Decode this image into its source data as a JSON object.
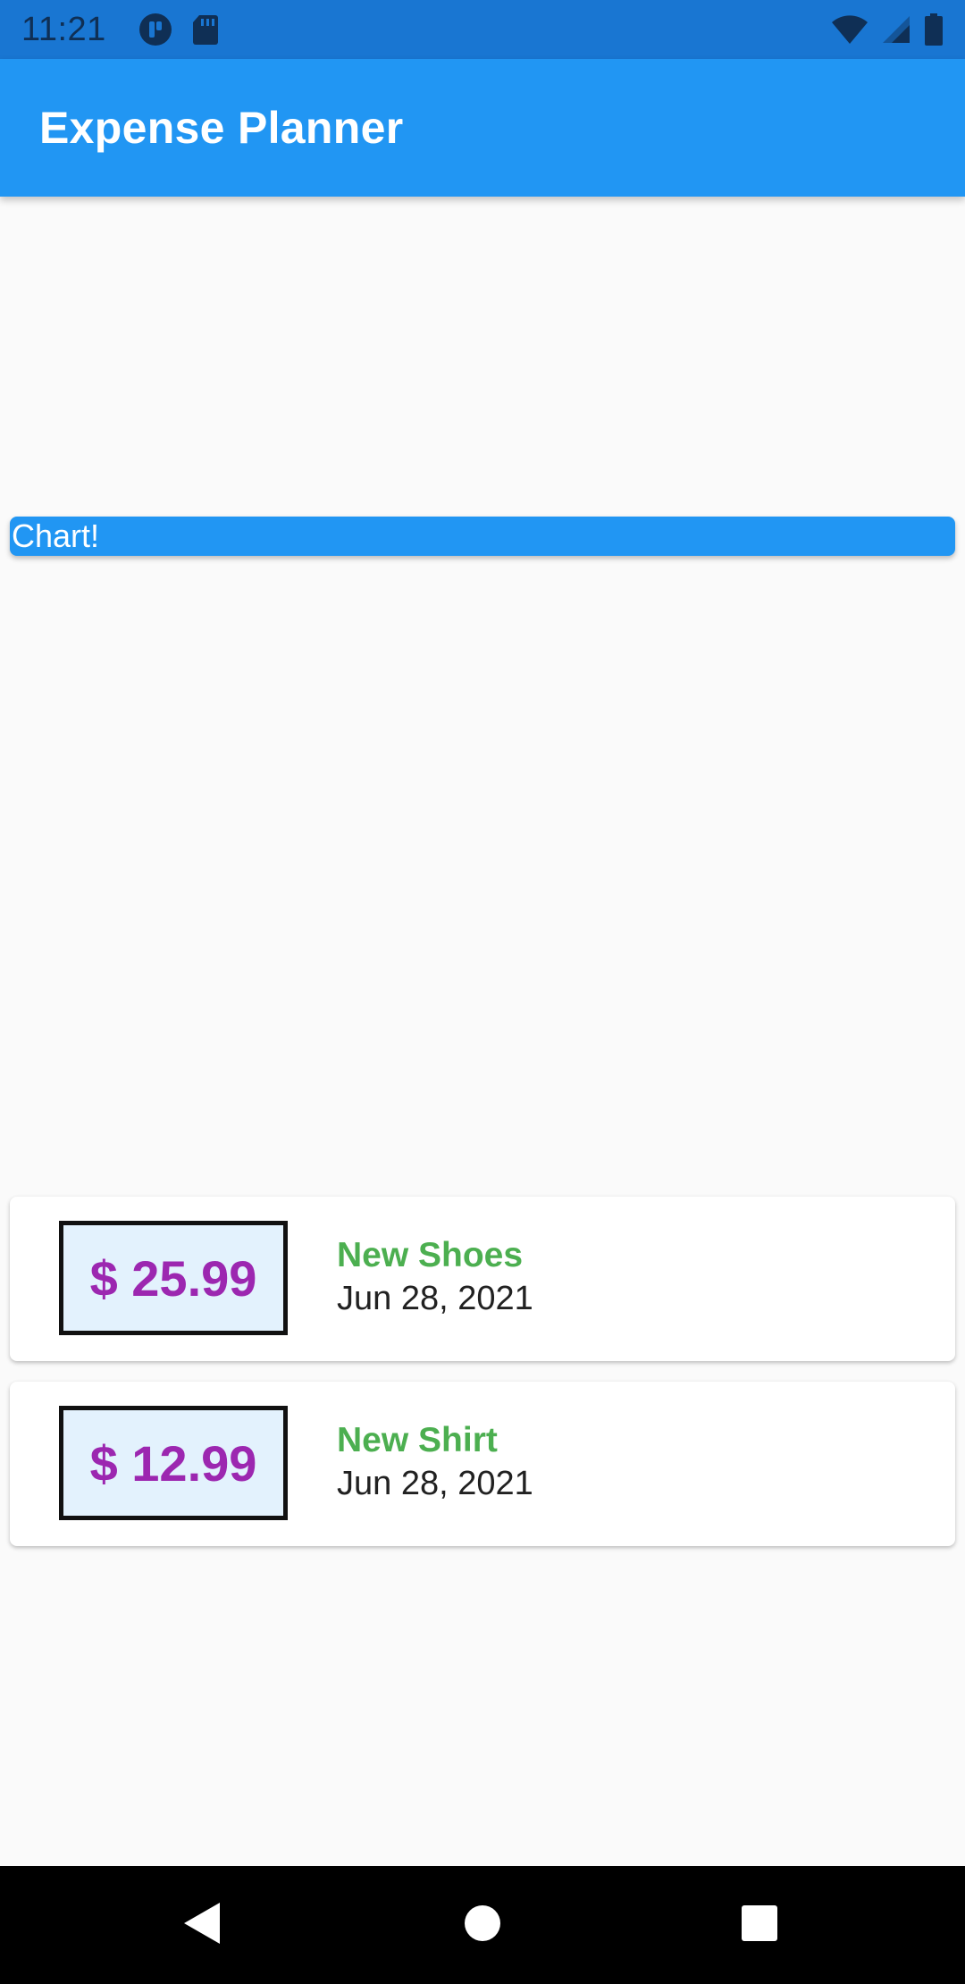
{
  "status_bar": {
    "time": "11:21",
    "left_icons": [
      "app-notification-icon",
      "sd-card-icon"
    ],
    "right_icons": [
      "wifi-icon",
      "cell-signal-icon",
      "battery-icon"
    ]
  },
  "app_bar": {
    "title": "Expense Planner",
    "color": "#2196f3"
  },
  "chart_card": {
    "label": "Chart!",
    "color": "#2196f3"
  },
  "transactions": [
    {
      "amount": "$ 25.99",
      "title": "New Shoes",
      "date": "Jun 28, 2021"
    },
    {
      "amount": "$ 12.99",
      "title": "New Shirt",
      "date": "Jun 28, 2021"
    }
  ],
  "colors": {
    "amount_text": "#9c27b0",
    "title_text": "#4caf50",
    "amount_box_bg": "#e3f2fd"
  },
  "nav_bar": {
    "icons": [
      "back-icon",
      "home-icon",
      "recents-icon"
    ]
  }
}
